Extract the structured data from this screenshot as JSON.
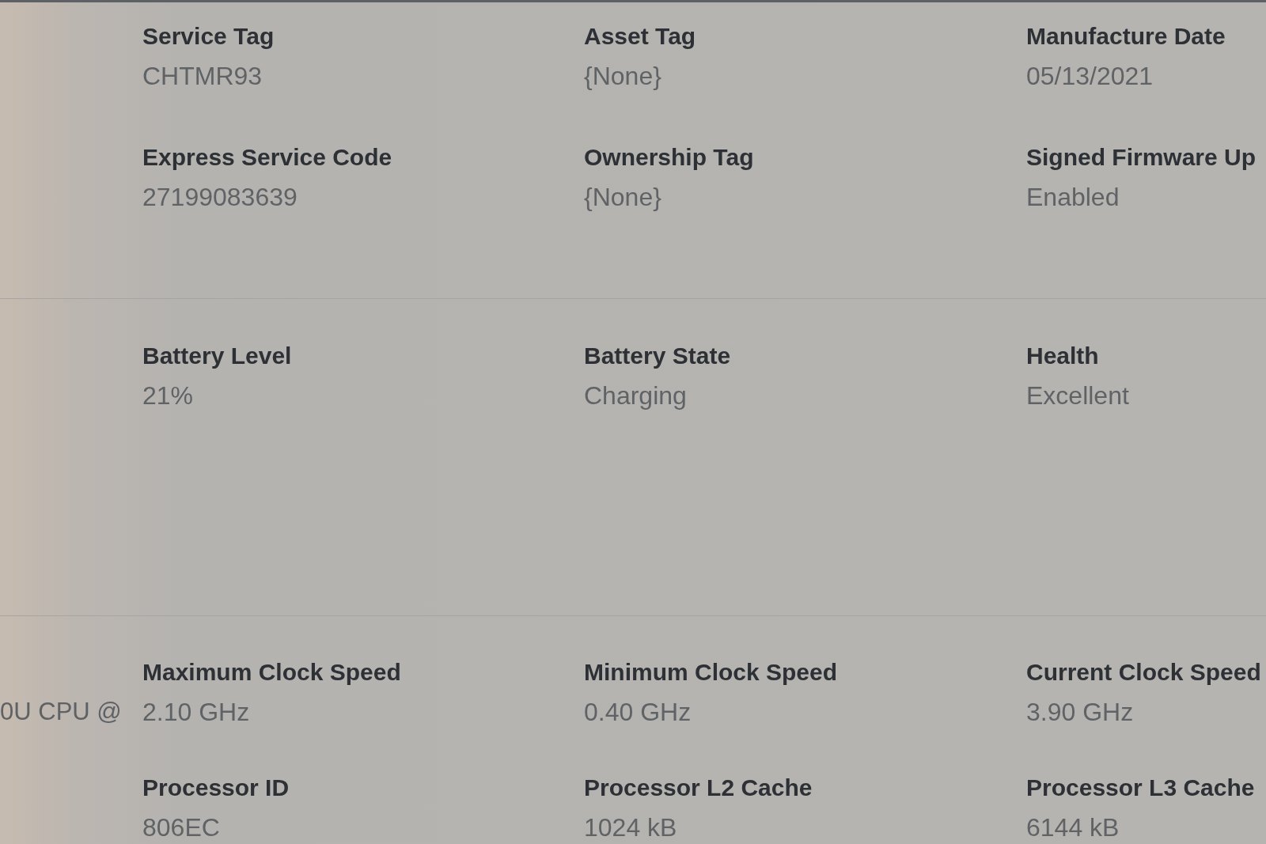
{
  "sections": [
    {
      "fields": [
        {
          "label": "Service Tag",
          "value": "CHTMR93"
        },
        {
          "label": "Asset Tag",
          "value": "{None}"
        },
        {
          "label": "Manufacture Date",
          "value": "05/13/2021"
        },
        {
          "label": "Express Service Code",
          "value": "27199083639"
        },
        {
          "label": "Ownership Tag",
          "value": "{None}"
        },
        {
          "label": "Signed Firmware Up",
          "value": "Enabled"
        }
      ]
    },
    {
      "fields": [
        {
          "label": "Battery Level",
          "value": "21%"
        },
        {
          "label": "Battery State",
          "value": "Charging"
        },
        {
          "label": "Health",
          "value": "Excellent"
        }
      ]
    },
    {
      "side_text": "0U CPU @",
      "fields": [
        {
          "label": "Maximum Clock Speed",
          "value": "2.10 GHz"
        },
        {
          "label": "Minimum Clock Speed",
          "value": "0.40 GHz"
        },
        {
          "label": "Current Clock Speed",
          "value": "3.90 GHz"
        },
        {
          "label": "Processor ID",
          "value": "806EC"
        },
        {
          "label": "Processor L2 Cache",
          "value": "1024 kB"
        },
        {
          "label": "Processor L3 Cache",
          "value": "6144 kB"
        }
      ]
    }
  ]
}
